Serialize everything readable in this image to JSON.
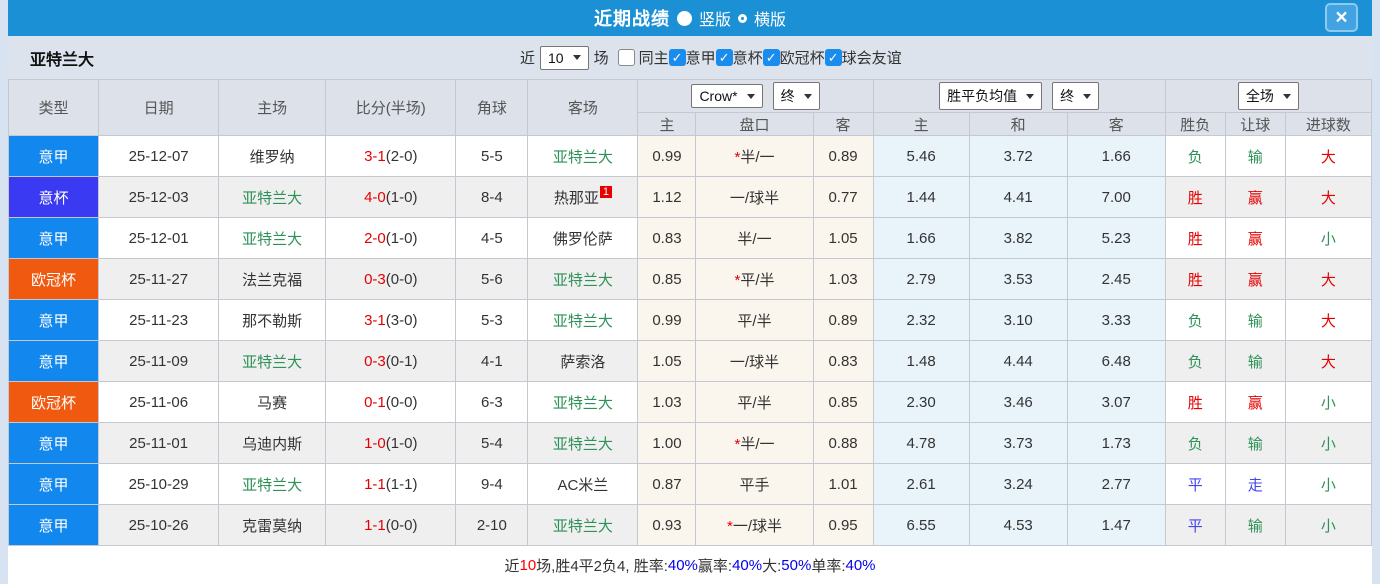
{
  "title_bar": {
    "title": "近期战绩",
    "radios": [
      {
        "label": "竖版",
        "selected": true
      },
      {
        "label": "横版",
        "selected": false
      }
    ],
    "close_glyph": "×"
  },
  "filter_bar": {
    "team_name": "亚特兰大",
    "near_label": "近",
    "near_count": "10",
    "unit_label": "场",
    "same_home_label": "同主",
    "same_home_checked": false,
    "leagues": [
      {
        "label": "意甲",
        "checked": true
      },
      {
        "label": "意杯",
        "checked": true
      },
      {
        "label": "欧冠杯",
        "checked": true
      },
      {
        "label": "球会友谊",
        "checked": true
      }
    ]
  },
  "table": {
    "selects": {
      "company": "Crow*",
      "company_time": "终",
      "avg_type": "胜平负均值",
      "avg_time": "终",
      "period": "全场"
    },
    "columns": {
      "type": "类型",
      "date": "日期",
      "home": "主场",
      "score": "比分(半场)",
      "corner": "角球",
      "away": "客场",
      "odds_home": "主",
      "odds_handicap": "盘口",
      "odds_away": "客",
      "avg_home": "主",
      "avg_draw": "和",
      "avg_away": "客",
      "result": "胜负",
      "let_result": "让球",
      "goals": "进球数"
    },
    "accent_colors": {
      "serie_a": "#1287ee",
      "coppa": "#3a3af2",
      "ucl": "#f05a10",
      "win_red": "#e60000",
      "lose_green": "#2e9158",
      "draw_violet": "#4444ee"
    },
    "rows": [
      {
        "league": "意甲",
        "date": "25-12-07",
        "home": "维罗纳",
        "score": "3-1",
        "half": "(2-0)",
        "corner": "5-5",
        "away": "亚特兰大",
        "star": "*",
        "handicap": "半/一",
        "odds_home": "0.99",
        "odds_away": "0.89",
        "avg_home": "5.46",
        "avg_draw": "3.72",
        "avg_away": "1.66",
        "result": "负",
        "let_result": "输",
        "goals": "大"
      },
      {
        "league": "意杯",
        "date": "25-12-03",
        "home": "亚特兰大",
        "score": "4-0",
        "half": "(1-0)",
        "corner": "8-4",
        "away": "热那亚",
        "away_sup": "1",
        "star": "",
        "handicap": "一/球半",
        "odds_home": "1.12",
        "odds_away": "0.77",
        "avg_home": "1.44",
        "avg_draw": "4.41",
        "avg_away": "7.00",
        "result": "胜",
        "let_result": "赢",
        "goals": "大"
      },
      {
        "league": "意甲",
        "date": "25-12-01",
        "home": "亚特兰大",
        "score": "2-0",
        "half": "(1-0)",
        "corner": "4-5",
        "away": "佛罗伦萨",
        "star": "",
        "handicap": "半/一",
        "odds_home": "0.83",
        "odds_away": "1.05",
        "avg_home": "1.66",
        "avg_draw": "3.82",
        "avg_away": "5.23",
        "result": "胜",
        "let_result": "赢",
        "goals": "小"
      },
      {
        "league": "欧冠杯",
        "date": "25-11-27",
        "home": "法兰克福",
        "score": "0-3",
        "half": "(0-0)",
        "corner": "5-6",
        "away": "亚特兰大",
        "star": "*",
        "handicap": "平/半",
        "odds_home": "0.85",
        "odds_away": "1.03",
        "avg_home": "2.79",
        "avg_draw": "3.53",
        "avg_away": "2.45",
        "result": "胜",
        "let_result": "赢",
        "goals": "大"
      },
      {
        "league": "意甲",
        "date": "25-11-23",
        "home": "那不勒斯",
        "score": "3-1",
        "half": "(3-0)",
        "corner": "5-3",
        "away": "亚特兰大",
        "star": "",
        "handicap": "平/半",
        "odds_home": "0.99",
        "odds_away": "0.89",
        "avg_home": "2.32",
        "avg_draw": "3.10",
        "avg_away": "3.33",
        "result": "负",
        "let_result": "输",
        "goals": "大"
      },
      {
        "league": "意甲",
        "date": "25-11-09",
        "home": "亚特兰大",
        "score": "0-3",
        "half": "(0-1)",
        "corner": "4-1",
        "away": "萨索洛",
        "star": "",
        "handicap": "一/球半",
        "odds_home": "1.05",
        "odds_away": "0.83",
        "avg_home": "1.48",
        "avg_draw": "4.44",
        "avg_away": "6.48",
        "result": "负",
        "let_result": "输",
        "goals": "大"
      },
      {
        "league": "欧冠杯",
        "date": "25-11-06",
        "home": "马赛",
        "score": "0-1",
        "half": "(0-0)",
        "corner": "6-3",
        "away": "亚特兰大",
        "star": "",
        "handicap": "平/半",
        "odds_home": "1.03",
        "odds_away": "0.85",
        "avg_home": "2.30",
        "avg_draw": "3.46",
        "avg_away": "3.07",
        "result": "胜",
        "let_result": "赢",
        "goals": "小"
      },
      {
        "league": "意甲",
        "date": "25-11-01",
        "home": "乌迪内斯",
        "score": "1-0",
        "half": "(1-0)",
        "corner": "5-4",
        "away": "亚特兰大",
        "star": "*",
        "handicap": "半/一",
        "odds_home": "1.00",
        "odds_away": "0.88",
        "avg_home": "4.78",
        "avg_draw": "3.73",
        "avg_away": "1.73",
        "result": "负",
        "let_result": "输",
        "goals": "小"
      },
      {
        "league": "意甲",
        "date": "25-10-29",
        "home": "亚特兰大",
        "score": "1-1",
        "half": "(1-1)",
        "corner": "9-4",
        "away": "AC米兰",
        "star": "",
        "handicap": "平手",
        "odds_home": "0.87",
        "odds_away": "1.01",
        "avg_home": "2.61",
        "avg_draw": "3.24",
        "avg_away": "2.77",
        "result": "平",
        "let_result": "走",
        "goals": "小"
      },
      {
        "league": "意甲",
        "date": "25-10-26",
        "home": "克雷莫纳",
        "score": "1-1",
        "half": "(0-0)",
        "corner": "2-10",
        "away": "亚特兰大",
        "star": "*",
        "handicap": "一/球半",
        "odds_home": "0.93",
        "odds_away": "0.95",
        "avg_home": "6.55",
        "avg_draw": "4.53",
        "avg_away": "1.47",
        "result": "平",
        "let_result": "输",
        "goals": "小"
      }
    ]
  },
  "footer": {
    "seg1": "近",
    "count": "10",
    "seg2": "场,胜4平2负4, 胜率:",
    "win_rate": "40%",
    "seg3": " 赢率:",
    "handicap_rate": "40%",
    "seg4": " 大:",
    "big_rate": "50%",
    "seg5": " 单率:",
    "odd_rate": "40%"
  }
}
